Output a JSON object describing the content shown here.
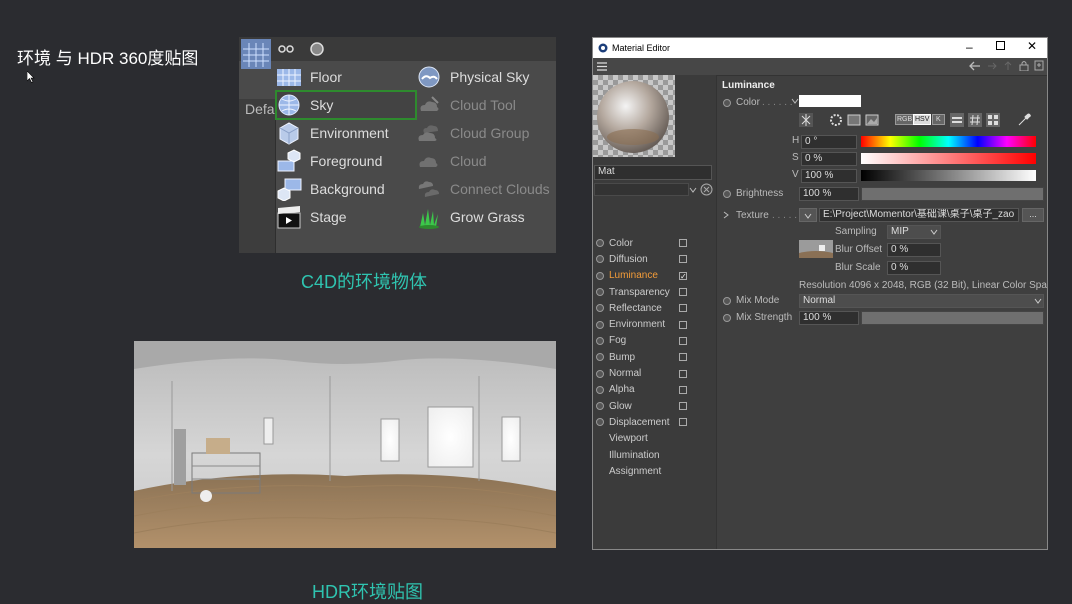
{
  "slide": {
    "title": "环境 与 HDR 360度贴图",
    "caption_c4d": "C4D的环境物体",
    "caption_hdr": "HDR环境贴图"
  },
  "c4d_menu": {
    "left_tab_label": "Defa",
    "left_column": [
      {
        "label": "Floor",
        "icon": "floor-icon"
      },
      {
        "label": "Sky",
        "icon": "sky-icon",
        "selected": true
      },
      {
        "label": "Environment",
        "icon": "environment-icon"
      },
      {
        "label": "Foreground",
        "icon": "foreground-icon"
      },
      {
        "label": "Background",
        "icon": "background-icon"
      },
      {
        "label": "Stage",
        "icon": "stage-icon"
      }
    ],
    "right_column": [
      {
        "label": "Physical Sky",
        "icon": "physical-sky-icon"
      },
      {
        "label": "Cloud Tool",
        "icon": "cloud-tool-icon",
        "disabled": true
      },
      {
        "label": "Cloud Group",
        "icon": "cloud-group-icon",
        "disabled": true
      },
      {
        "label": "Cloud",
        "icon": "cloud-icon",
        "disabled": true
      },
      {
        "label": "Connect Clouds",
        "icon": "connect-clouds-icon",
        "disabled": true
      },
      {
        "label": "Grow Grass",
        "icon": "grow-grass-icon"
      }
    ],
    "colors": {
      "selected_outline": "#2e8b2e"
    }
  },
  "material_editor": {
    "window_title": "Material Editor",
    "material_name": "Mat",
    "channels": [
      {
        "label": "Color",
        "checked": false,
        "has_toggle": true
      },
      {
        "label": "Diffusion",
        "checked": false,
        "has_toggle": true
      },
      {
        "label": "Luminance",
        "checked": true,
        "has_toggle": true,
        "active": true
      },
      {
        "label": "Transparency",
        "checked": false,
        "has_toggle": true
      },
      {
        "label": "Reflectance",
        "checked": false,
        "has_toggle": true
      },
      {
        "label": "Environment",
        "checked": false,
        "has_toggle": true
      },
      {
        "label": "Fog",
        "checked": false,
        "has_toggle": true
      },
      {
        "label": "Bump",
        "checked": false,
        "has_toggle": true
      },
      {
        "label": "Normal",
        "checked": false,
        "has_toggle": true
      },
      {
        "label": "Alpha",
        "checked": false,
        "has_toggle": true
      },
      {
        "label": "Glow",
        "checked": false,
        "has_toggle": true
      },
      {
        "label": "Displacement",
        "checked": false,
        "has_toggle": true
      },
      {
        "label": "Viewport",
        "has_toggle": false
      },
      {
        "label": "Illumination",
        "has_toggle": false
      },
      {
        "label": "Assignment",
        "has_toggle": false
      }
    ],
    "section_title": "Luminance",
    "color_label": "Color",
    "h_label": "H",
    "h_value": "0 °",
    "s_label": "S",
    "s_value": "0 %",
    "v_label": "V",
    "v_value": "100 %",
    "brightness_label": "Brightness",
    "brightness_value": "100 %",
    "texture_label": "Texture",
    "texture_path": "E:\\Project\\Momentor\\基础课\\桌子\\桌子_zao",
    "texture_more": "...",
    "sampling_label": "Sampling",
    "sampling_value": "MIP",
    "blur_offset_label": "Blur Offset",
    "blur_offset_value": "0 %",
    "blur_scale_label": "Blur Scale",
    "blur_scale_value": "0 %",
    "resolution_text": "Resolution 4096 x 2048, RGB (32 Bit), Linear Color Space",
    "mix_mode_label": "Mix Mode",
    "mix_mode_value": "Normal",
    "mix_strength_label": "Mix Strength",
    "mix_strength_value": "100 %",
    "mode_buttons": [
      "RGB",
      "HSV",
      "K"
    ],
    "brightness_level": 1.0,
    "mix_strength_level": 1.0,
    "colors": {
      "active_channel": "#f39c39",
      "swatch": "#ffffff"
    }
  }
}
